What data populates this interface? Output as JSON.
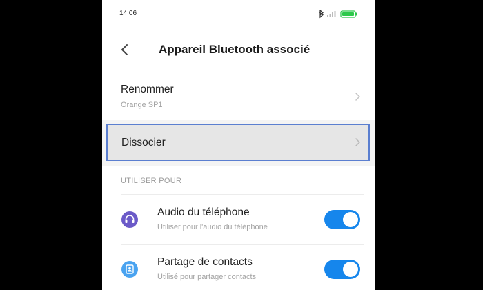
{
  "status_bar": {
    "time": "14:06",
    "icons": [
      "bluetooth-icon",
      "signal-icon",
      "battery-icon"
    ],
    "battery_color": "#2cc84a"
  },
  "header": {
    "title": "Appareil Bluetooth associé",
    "back_icon": "chevron-left-icon"
  },
  "rename": {
    "label": "Renommer",
    "value": "Orange SP1"
  },
  "dissociate": {
    "label": "Dissocier"
  },
  "section": {
    "label": "UTILISER POUR"
  },
  "features": [
    {
      "label": "Audio du téléphone",
      "description": "Utiliser pour l'audio du téléphone",
      "icon": "headset-icon",
      "icon_color": "#6b5ac8",
      "enabled": true
    },
    {
      "label": "Partage de contacts",
      "description": "Utilisé pour partager contacts",
      "icon": "contact-card-icon",
      "icon_color": "#4aa3f0",
      "enabled": true
    }
  ],
  "colors": {
    "accent": "#1686ec",
    "selection_border": "#5b7fd0"
  }
}
